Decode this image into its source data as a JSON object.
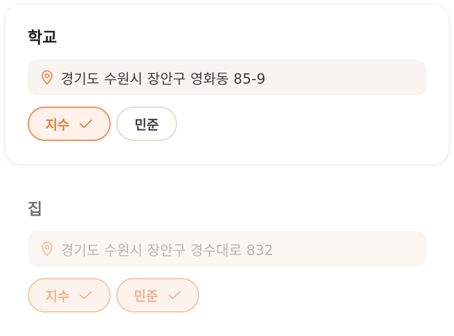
{
  "school": {
    "title": "학교",
    "address": "경기도 수원시 장안구 영화동 85-9",
    "chips": [
      {
        "label": "지수",
        "selected": true
      },
      {
        "label": "민준",
        "selected": false
      }
    ]
  },
  "home": {
    "title": "집",
    "address": "경기도 수원시 장안구 경수대로 832",
    "chips": [
      {
        "label": "지수",
        "selected": true
      },
      {
        "label": "민준",
        "selected": true
      }
    ]
  },
  "colors": {
    "accent": "#ea7a3e",
    "accent_border": "#f0915e",
    "faded_accent": "#f4b08b",
    "address_bg": "#f8f4ef"
  },
  "icons": {
    "location": "map-pin-icon",
    "check": "check-icon"
  }
}
